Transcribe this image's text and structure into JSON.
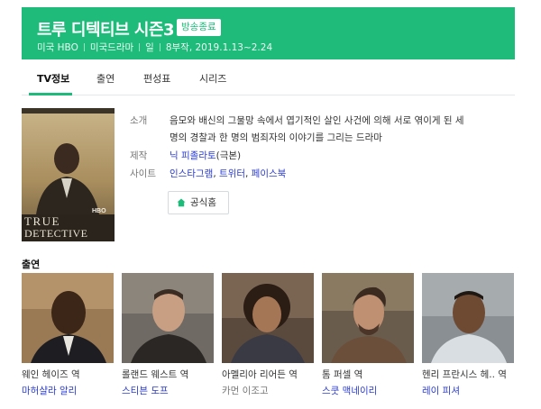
{
  "header": {
    "title": "트루 디텍티브 시즌3",
    "badge": "방송종료",
    "meta": [
      "미국 HBO",
      "미국드라마",
      "일",
      "8부작, 2019.1.13~2.24"
    ],
    "bg_color": "#1ebb7a"
  },
  "tabs": [
    {
      "label": "TV정보",
      "active": true
    },
    {
      "label": "출연",
      "active": false
    },
    {
      "label": "편성표",
      "active": false
    },
    {
      "label": "시리즈",
      "active": false
    }
  ],
  "poster": {
    "wordmark_top": "TRUE",
    "wordmark_bottom": "DETECTIVE",
    "network": "HBO"
  },
  "info": {
    "synopsis_label": "소개",
    "synopsis_line1": "음모와 배신의 그물망 속에서 엽기적인 살인 사건에 의해 서로 엮이게 된 세",
    "synopsis_line2": "명의 경찰과 한 명의 범죄자의 이야기를 그리는 드라마",
    "producer_label": "제작",
    "producer_name": "닉 피졸라토",
    "producer_role": "(극본)",
    "site_label": "사이트",
    "sites": [
      "인스타그램",
      "트위터",
      "페이스북"
    ],
    "sites_sep": ", ",
    "home_button": "공식홈"
  },
  "cast_section": {
    "title": "출연",
    "members": [
      {
        "role": "웨인 헤이즈 역",
        "actor": "마허샬라 알리",
        "linked": true
      },
      {
        "role": "롤랜드 웨스트 역",
        "actor": "스티븐 도프",
        "linked": true
      },
      {
        "role": "아멜리아 리어든 역",
        "actor": "카먼 이조고",
        "linked": false
      },
      {
        "role": "톰 퍼셀 역",
        "actor": "스쿳 맥네이리",
        "linked": true
      },
      {
        "role": "헨리 프란시스 헤.. 역",
        "actor": "레이 피셔",
        "linked": true
      }
    ]
  },
  "colors": {
    "accent": "#1ebb7a",
    "link": "#2a3bd0"
  }
}
